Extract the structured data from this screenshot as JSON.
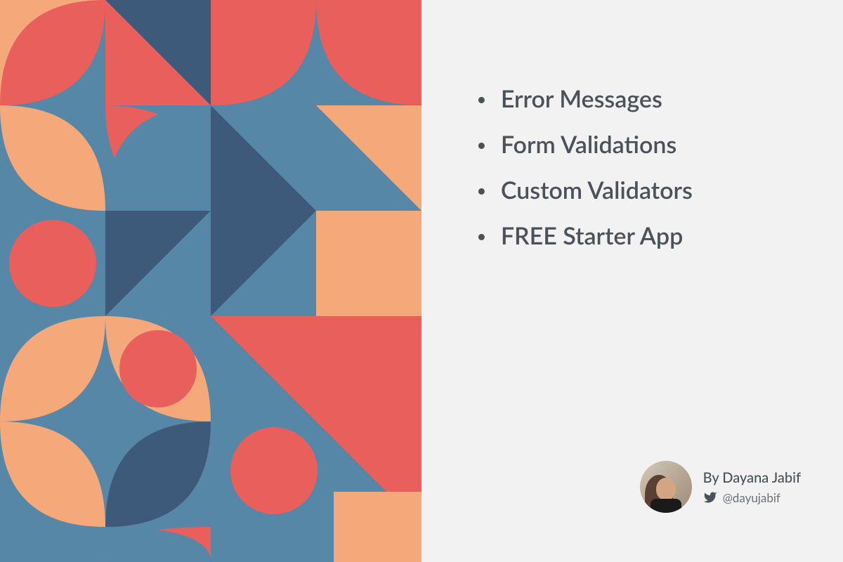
{
  "bullets": [
    "Error Messages",
    "Form Validations",
    "Custom Validators",
    "FREE Starter App"
  ],
  "author": {
    "byline": "By Dayana Jabif",
    "handle": "@dayujabif"
  },
  "colors": {
    "blue": "#5687a7",
    "darkBlue": "#3d5a7a",
    "coral": "#e85f5c",
    "peach": "#f5a97a",
    "background": "#f2f2f2",
    "text": "#4a5158"
  }
}
